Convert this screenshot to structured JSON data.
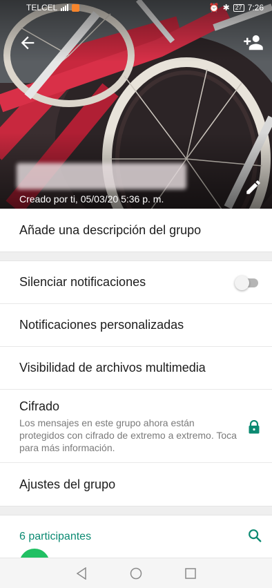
{
  "status_bar": {
    "carrier": "TELCEL",
    "time": "7:26",
    "battery": "27"
  },
  "header": {
    "created_text": "Creado por ti, 05/03/20 5:36 p. m.",
    "icons": {
      "back": "back-arrow-icon",
      "add_participant": "add-person-icon",
      "edit": "pencil-icon"
    }
  },
  "rows": {
    "description": "Añade una descripción del grupo",
    "mute": "Silenciar notificaciones",
    "custom_notifications": "Notificaciones personalizadas",
    "media_visibility": "Visibilidad de archivos multimedia",
    "encryption_title": "Cifrado",
    "encryption_subtitle": "Los mensajes en este grupo ahora están protegidos con cifrado de extremo a extremo. Toca para más información.",
    "group_settings": "Ajustes del grupo"
  },
  "toggles": {
    "mute_enabled": false
  },
  "participants": {
    "count_label": "6 participantes"
  },
  "colors": {
    "accent": "#0b8a72",
    "accent_green": "#21c063",
    "lock": "#0b8a72"
  }
}
